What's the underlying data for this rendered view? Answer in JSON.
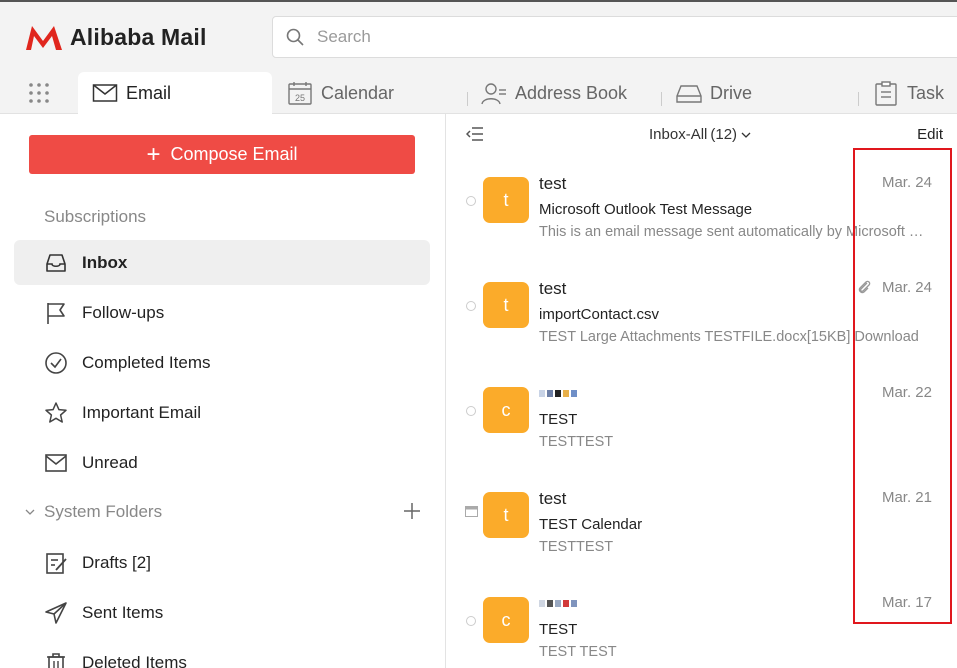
{
  "app": {
    "title": "Alibaba Mail",
    "brand_color": "#e0261d"
  },
  "search": {
    "placeholder": "Search"
  },
  "tabs": [
    {
      "label": "Email",
      "icon": "mail-icon",
      "active": true
    },
    {
      "label": "Calendar",
      "icon": "calendar-icon",
      "badge": "25"
    },
    {
      "label": "Address Book",
      "icon": "contacts-icon"
    },
    {
      "label": "Drive",
      "icon": "drive-icon"
    },
    {
      "label": "Task",
      "icon": "task-icon"
    }
  ],
  "sidebar": {
    "compose_label": "Compose Email",
    "compose_color": "#ef4b45",
    "subscriptions_label": "Subscriptions",
    "items": [
      {
        "label": "Inbox",
        "icon": "inbox-icon",
        "active": true
      },
      {
        "label": "Follow-ups",
        "icon": "flag-icon"
      },
      {
        "label": "Completed Items",
        "icon": "check-circle-icon"
      },
      {
        "label": "Important Email",
        "icon": "star-icon"
      },
      {
        "label": "Unread",
        "icon": "envelope-icon"
      }
    ],
    "system_folders_label": "System Folders",
    "system_items": [
      {
        "label": "Drafts [2]",
        "icon": "drafts-icon"
      },
      {
        "label": "Sent Items",
        "icon": "send-icon"
      },
      {
        "label": "Deleted Items",
        "icon": "trash-icon"
      }
    ]
  },
  "mail_list": {
    "folder_label": "Inbox-All",
    "count": "(12)",
    "edit_label": "Edit",
    "avatar_color": "#fbab2a",
    "messages": [
      {
        "avatar": "t",
        "sender": "test",
        "subject": "Microsoft Outlook Test Message",
        "preview": "This is an email message sent automatically by Microsoft Outlook while testing the settings for your account.",
        "date": "Mar. 24",
        "attachment": false
      },
      {
        "avatar": "t",
        "sender": "test",
        "subject": "importContact.csv",
        "preview": "TEST Large Attachments TESTFILE.docx[15KB] Download",
        "date": "Mar. 24",
        "attachment": true
      },
      {
        "avatar": "c",
        "sender": "",
        "subject": "TEST",
        "preview": "TESTTEST",
        "date": "Mar. 22",
        "attachment": false
      },
      {
        "avatar": "t",
        "sender": "test",
        "subject": "TEST Calendar",
        "preview": "TESTTEST",
        "date": "Mar. 21",
        "attachment": false
      },
      {
        "avatar": "c",
        "sender": "",
        "subject": "TEST",
        "preview": "TEST TEST",
        "date": "Mar. 17",
        "attachment": false
      }
    ]
  }
}
